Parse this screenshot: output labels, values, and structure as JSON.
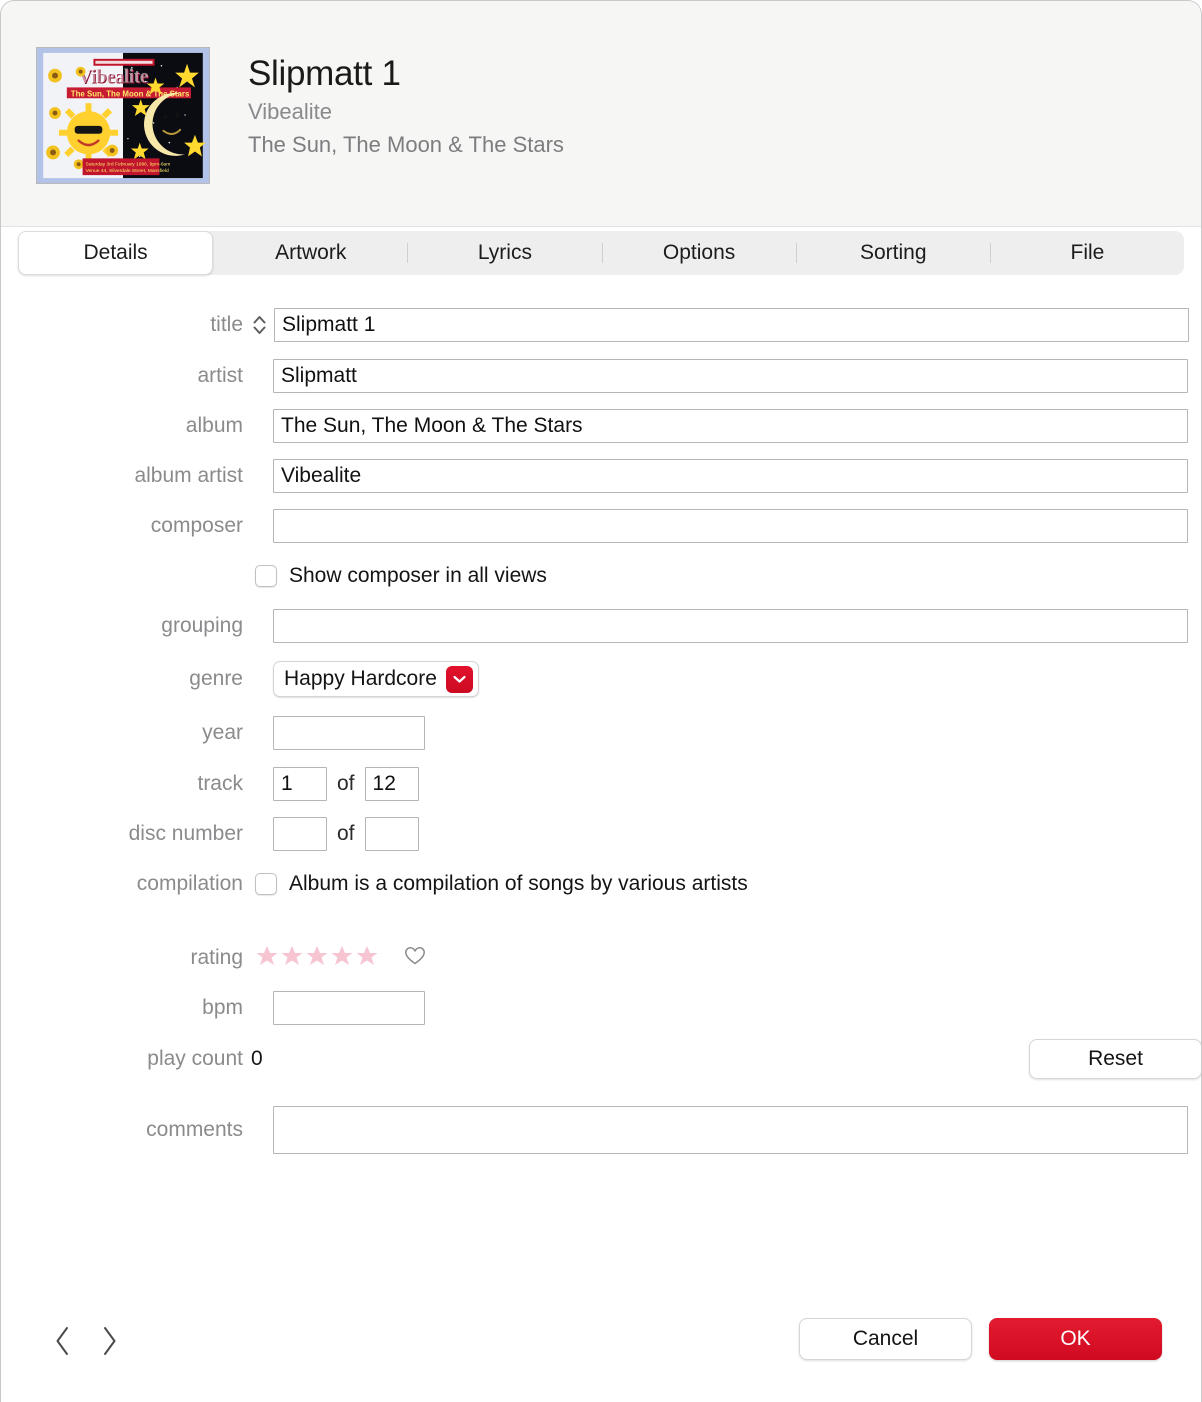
{
  "window": {
    "role": "track-info-dialog"
  },
  "header": {
    "title": "Slipmatt 1",
    "subtitle": "Vibealite",
    "album_line": "The Sun, The Moon & The Stars",
    "artwork_alt": "Vibealite - The Sun, The Moon & The Stars",
    "artwork_text": {
      "banner": "RAVE PROMOTION",
      "brand": "Vibealite",
      "tagline": "The Sun, The Moon & The Stars",
      "footer_line1": "Saturday 3rd February 1996, 9pm-6am",
      "footer_line2": "Venue 44, Silverdale Street, Mansfield"
    }
  },
  "tabs": [
    {
      "label": "Details",
      "active": true
    },
    {
      "label": "Artwork",
      "active": false
    },
    {
      "label": "Lyrics",
      "active": false
    },
    {
      "label": "Options",
      "active": false
    },
    {
      "label": "Sorting",
      "active": false
    },
    {
      "label": "File",
      "active": false
    }
  ],
  "fields": {
    "title": {
      "label": "title",
      "value": "Slipmatt 1"
    },
    "artist": {
      "label": "artist",
      "value": "Slipmatt"
    },
    "album": {
      "label": "album",
      "value": "The Sun, The Moon & The Stars"
    },
    "album_artist": {
      "label": "album artist",
      "value": "Vibealite"
    },
    "composer": {
      "label": "composer",
      "value": ""
    },
    "show_composer": {
      "label": "Show composer in all views",
      "checked": false
    },
    "grouping": {
      "label": "grouping",
      "value": ""
    },
    "genre": {
      "label": "genre",
      "value": "Happy Hardcore"
    },
    "year": {
      "label": "year",
      "value": ""
    },
    "track": {
      "label": "track",
      "number": "1",
      "of_label": "of",
      "total": "12"
    },
    "disc": {
      "label": "disc number",
      "number": "",
      "of_label": "of",
      "total": ""
    },
    "compilation": {
      "label": "compilation",
      "text": "Album is a compilation of songs by various artists",
      "checked": false
    },
    "rating": {
      "label": "rating",
      "stars": 5,
      "filled": 0
    },
    "bpm": {
      "label": "bpm",
      "value": ""
    },
    "play_count": {
      "label": "play count",
      "value": "0",
      "reset_label": "Reset"
    },
    "comments": {
      "label": "comments",
      "value": ""
    }
  },
  "footer": {
    "previous_label": "Previous",
    "next_label": "Next",
    "cancel_label": "Cancel",
    "ok_label": "OK"
  },
  "colors": {
    "accent_red": "#d00a20",
    "star_pink": "#f6c2cf",
    "label_gray": "#8b8b8e",
    "header_bg": "#f6f6f4"
  }
}
